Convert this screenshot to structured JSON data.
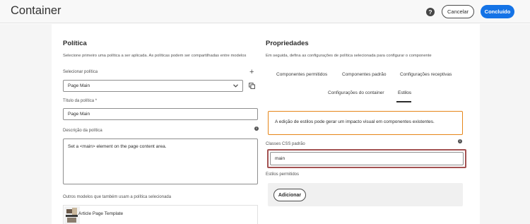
{
  "header": {
    "title": "Container",
    "help_icon": "?",
    "cancel_label": "Cancelar",
    "done_label": "Concluído"
  },
  "policy": {
    "heading": "Política",
    "description": "Selecione primeiro uma política a ser aplicada. As políticas podem ser compartilhadas entre modelos",
    "select_label": "Selecionar política",
    "select_value": "Page Main",
    "add_icon": "+",
    "title_label": "Título da política *",
    "title_value": "Page Main",
    "description_label": "Descrição da política",
    "description_value": "Set a <main> element on the page content area.",
    "other_templates_label": "Outros modelos que também usam a política selecionada",
    "template_name": "Article Page Template"
  },
  "properties": {
    "heading": "Propriedades",
    "description": "Em seguida, defina as configurações de política selecionada para configurar o componente",
    "tabs": [
      {
        "label": "Componentes permitidos"
      },
      {
        "label": "Componentes padrão"
      },
      {
        "label": "Configurações receptivas"
      },
      {
        "label": "Configurações do container"
      },
      {
        "label": "Estilos"
      }
    ],
    "active_tab": "Estilos",
    "alert_text": "A edição de estilos pode gerar um impacto visual em componentes existentes.",
    "css_classes_label": "Classes CSS padrão",
    "css_classes_value": "main",
    "allowed_styles_label": "Estilos permitidos",
    "add_label": "Adicionar"
  },
  "colors": {
    "accent": "#1473e6",
    "warning": "#e68619",
    "highlight": "#a35252"
  }
}
